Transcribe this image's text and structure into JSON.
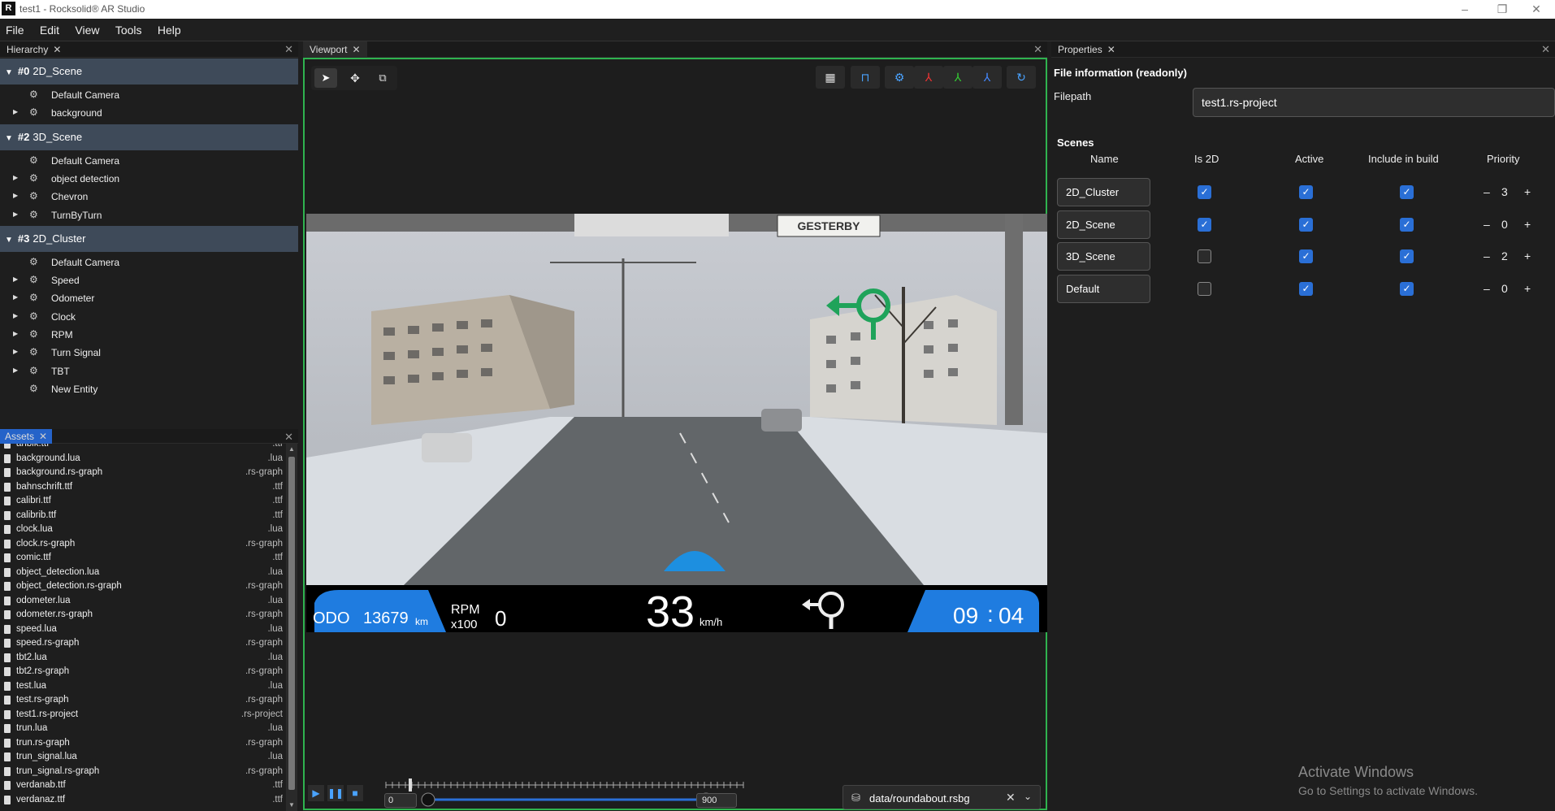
{
  "window": {
    "title": "test1 - Rocksolid® AR Studio",
    "app_icon": "rocksolid-logo-icon"
  },
  "menu": [
    "File",
    "Edit",
    "View",
    "Tools",
    "Help"
  ],
  "hierarchy": {
    "tab": "Hierarchy",
    "scenes": [
      {
        "id": "#0",
        "name": "2D_Scene",
        "entities": [
          {
            "name": "Default Camera",
            "expandable": false
          },
          {
            "name": "background",
            "expandable": true
          }
        ]
      },
      {
        "id": "#2",
        "name": "3D_Scene",
        "entities": [
          {
            "name": "Default Camera",
            "expandable": false
          },
          {
            "name": "object detection",
            "expandable": true
          },
          {
            "name": "Chevron",
            "expandable": true
          },
          {
            "name": "TurnByTurn",
            "expandable": true
          }
        ]
      },
      {
        "id": "#3",
        "name": "2D_Cluster",
        "entities": [
          {
            "name": "Default Camera",
            "expandable": false
          },
          {
            "name": "Speed",
            "expandable": true
          },
          {
            "name": "Odometer",
            "expandable": true
          },
          {
            "name": "Clock",
            "expandable": true
          },
          {
            "name": "RPM",
            "expandable": true
          },
          {
            "name": "Turn Signal",
            "expandable": true
          },
          {
            "name": "TBT",
            "expandable": true
          },
          {
            "name": "New Entity",
            "expandable": false
          }
        ]
      }
    ]
  },
  "assets": {
    "tab": "Assets",
    "files": [
      {
        "name": "ariblk.ttf",
        "ext": ".ttf"
      },
      {
        "name": "background.lua",
        "ext": ".lua"
      },
      {
        "name": "background.rs-graph",
        "ext": ".rs-graph"
      },
      {
        "name": "bahnschrift.ttf",
        "ext": ".ttf"
      },
      {
        "name": "calibri.ttf",
        "ext": ".ttf"
      },
      {
        "name": "calibrib.ttf",
        "ext": ".ttf"
      },
      {
        "name": "clock.lua",
        "ext": ".lua"
      },
      {
        "name": "clock.rs-graph",
        "ext": ".rs-graph"
      },
      {
        "name": "comic.ttf",
        "ext": ".ttf"
      },
      {
        "name": "object_detection.lua",
        "ext": ".lua"
      },
      {
        "name": "object_detection.rs-graph",
        "ext": ".rs-graph"
      },
      {
        "name": "odometer.lua",
        "ext": ".lua"
      },
      {
        "name": "odometer.rs-graph",
        "ext": ".rs-graph"
      },
      {
        "name": "speed.lua",
        "ext": ".lua"
      },
      {
        "name": "speed.rs-graph",
        "ext": ".rs-graph"
      },
      {
        "name": "tbt2.lua",
        "ext": ".lua"
      },
      {
        "name": "tbt2.rs-graph",
        "ext": ".rs-graph"
      },
      {
        "name": "test.lua",
        "ext": ".lua"
      },
      {
        "name": "test.rs-graph",
        "ext": ".rs-graph"
      },
      {
        "name": "test1.rs-project",
        "ext": ".rs-project"
      },
      {
        "name": "trun.lua",
        "ext": ".lua"
      },
      {
        "name": "trun.rs-graph",
        "ext": ".rs-graph"
      },
      {
        "name": "trun_signal.lua",
        "ext": ".lua"
      },
      {
        "name": "trun_signal.rs-graph",
        "ext": ".rs-graph"
      },
      {
        "name": "verdanab.ttf",
        "ext": ".ttf"
      },
      {
        "name": "verdanaz.ttf",
        "ext": ".ttf"
      }
    ]
  },
  "viewport": {
    "tab": "Viewport",
    "tools_left": [
      "select-cursor-icon",
      "move-icon",
      "scale-icon"
    ],
    "tools_right": [
      "grid-icon",
      "ruler-icon",
      "gear-icon",
      "axis-red-icon",
      "axis-green-icon",
      "axis-blue-icon",
      "refresh-icon"
    ],
    "street_sign": "GESTERBY",
    "cluster": {
      "odo_label": "ODO",
      "odo_value": "13679",
      "odo_unit": "km",
      "rpm_label": "RPM",
      "rpm_unit": "x100",
      "rpm_value": "0",
      "speed": "33",
      "speed_unit": "km/h",
      "clock_h": "09",
      "clock_sep": ":",
      "clock_m": "04"
    },
    "timeline": {
      "start": "0",
      "end": "900"
    },
    "data_file": "data/roundabout.rsbg"
  },
  "properties": {
    "tab": "Properties",
    "section": "File information (readonly)",
    "filepath_label": "Filepath",
    "filepath": "test1.rs-project",
    "scenes_label": "Scenes",
    "columns": [
      "Name",
      "Is 2D",
      "Active",
      "Include in build",
      "Priority"
    ],
    "rows": [
      {
        "name": "2D_Cluster",
        "is2d": true,
        "active": true,
        "build": true,
        "priority": "3"
      },
      {
        "name": "2D_Scene",
        "is2d": true,
        "active": true,
        "build": true,
        "priority": "0"
      },
      {
        "name": "3D_Scene",
        "is2d": false,
        "active": true,
        "build": true,
        "priority": "2"
      },
      {
        "name": "Default",
        "is2d": false,
        "active": true,
        "build": true,
        "priority": "0"
      }
    ]
  },
  "watermark": {
    "title": "Activate Windows",
    "sub": "Go to Settings to activate Windows."
  },
  "colors": {
    "accent": "#2fb34f",
    "selection": "#3e4a59",
    "checkbox": "#2a6fd6",
    "hud_blue": "#1f7ce0"
  }
}
